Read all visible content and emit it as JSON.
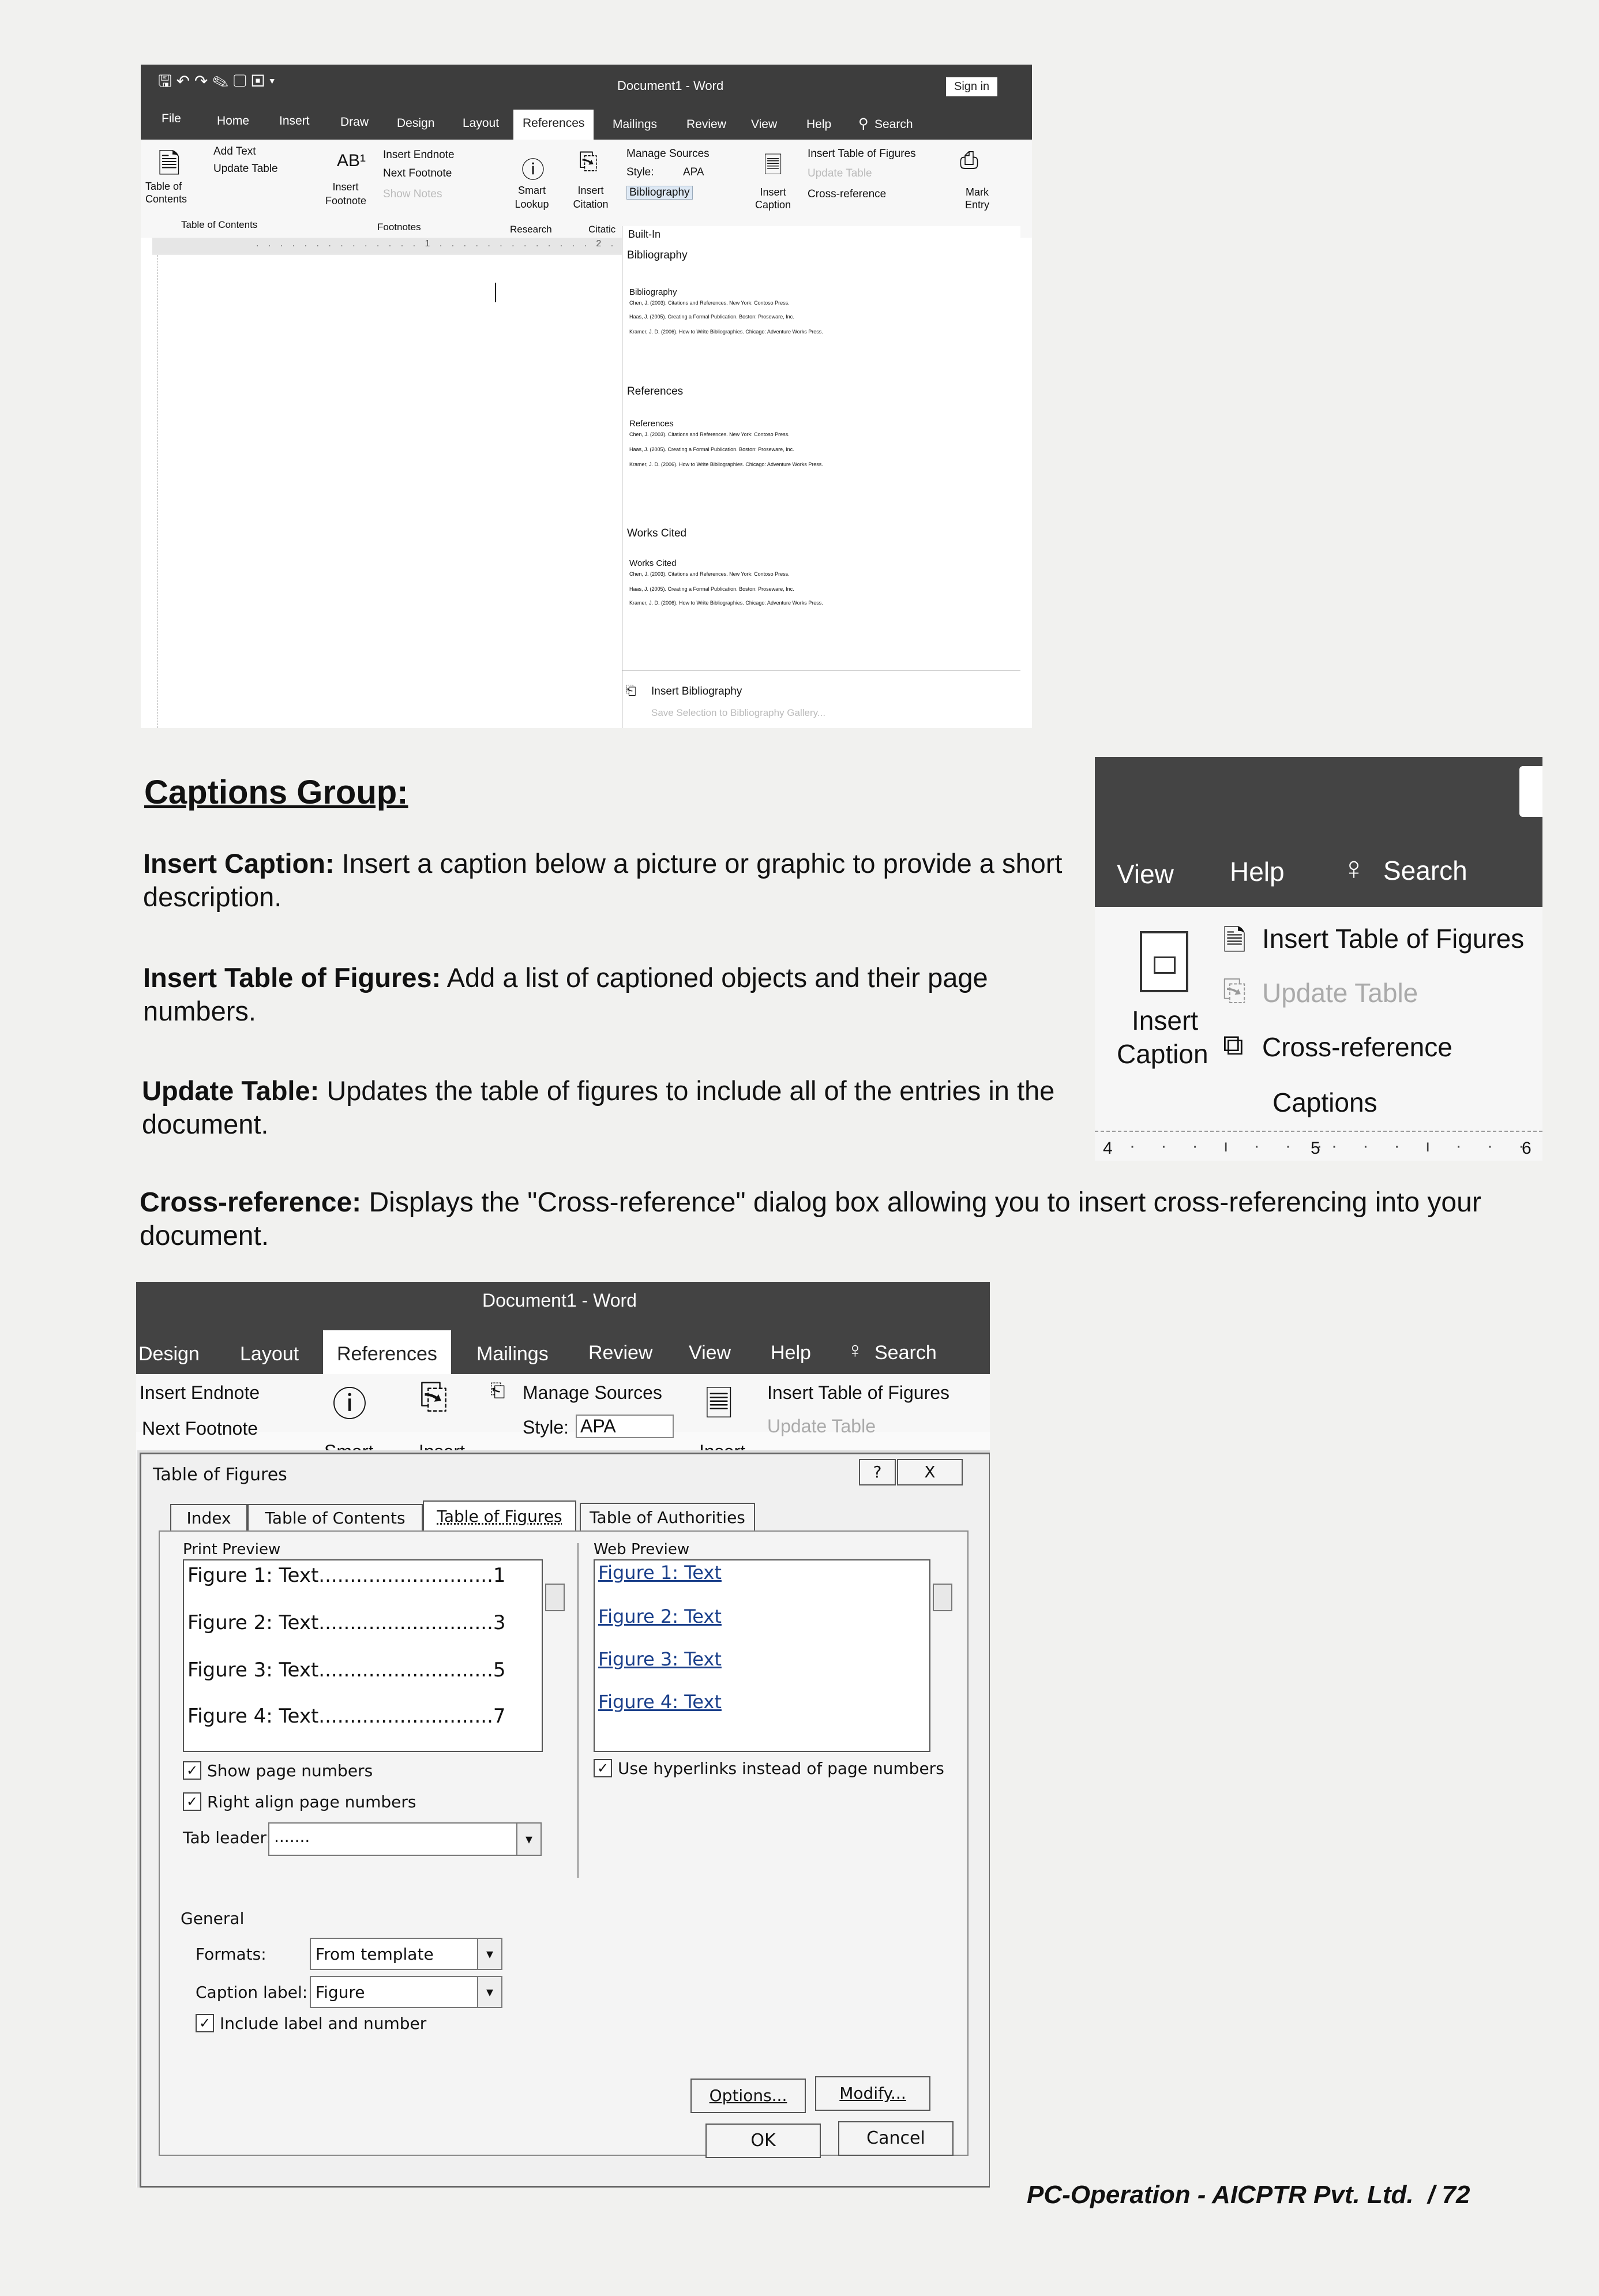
{
  "top_screenshot": {
    "title": "Document1 - Word",
    "sign_in": "Sign in",
    "tabs": [
      "File",
      "Home",
      "Insert",
      "Draw",
      "Design",
      "Layout",
      "References",
      "Mailings",
      "Review",
      "View",
      "Help",
      "Search"
    ],
    "ribbon": {
      "table_of_contents": "Table of Contents",
      "add_text": "Add Text",
      "update_table": "Update Table",
      "group_toc": "Table of Contents",
      "insert_footnote": "Insert Footnote",
      "insert_endnote": "Insert Endnote",
      "next_footnote": "Next Footnote",
      "show_notes": "Show Notes",
      "group_footnotes": "Footnotes",
      "smart_lookup": "Smart Lookup",
      "group_research": "Research",
      "insert_citation": "Insert Citation",
      "manage_sources": "Manage Sources",
      "style_label": "Style:",
      "style_value": "APA",
      "bibliography": "Bibliography",
      "group_citations": "Citatic",
      "insert_caption": "Insert Caption",
      "insert_table_of_figures": "Insert Table of Figures",
      "update_table2": "Update Table",
      "cross_reference": "Cross-reference",
      "mark_entry": "Mark Entry"
    },
    "dropdown": {
      "built_in": "Built-In",
      "sections": [
        {
          "header": "Bibliography",
          "title": "Bibliography"
        },
        {
          "header": "References",
          "title": "References"
        },
        {
          "header": "Works Cited",
          "title": "Works Cited"
        }
      ],
      "entries": [
        "Chen, J. (2003). Citations and References. New York: Contoso Press.",
        "Haas, J. (2005). Creating a Formal Publication. Boston: Proseware, Inc.",
        "Kramer, J. D. (2006). How to Write Bibliographies. Chicago: Adventure Works Press."
      ],
      "insert_bibliography": "Insert Bibliography",
      "save_selection": "Save Selection to Bibliography Gallery..."
    }
  },
  "heading": "Captions Group:",
  "paragraphs": [
    {
      "term": "Insert Caption:",
      "text": " Insert a caption below a picture or graphic to provide a short description."
    },
    {
      "term": "Insert Table of Figures:",
      "text": " Add a list of captioned objects and their page numbers."
    },
    {
      "term": "Update Table:",
      "text": " Updates the table of figures to include all of the entries in the document."
    },
    {
      "term": "Cross-reference:",
      "text": " Displays the \"Cross-reference\" dialog box allowing you to insert cross-referencing into your document."
    }
  ],
  "right_screenshot": {
    "tabs": [
      "View",
      "Help",
      "Search"
    ],
    "insert": "Insert",
    "caption": "Caption",
    "insert_table_of_figures": "Insert Table of Figures",
    "update_table": "Update Table",
    "cross_reference": "Cross-reference",
    "group": "Captions",
    "ruler": [
      "4",
      "5",
      "6"
    ]
  },
  "bottom_screenshot": {
    "title": "Document1 - Word",
    "tabs": [
      "Design",
      "Layout",
      "References",
      "Mailings",
      "Review",
      "View",
      "Help",
      "Search"
    ],
    "insert_endnote": "Insert Endnote",
    "next_footnote": "Next Footnote",
    "smart": "Smart",
    "insert": "Insert",
    "manage_sources": "Manage Sources",
    "style_label": "Style:",
    "style_value": "APA",
    "insert2": "Insert",
    "insert_table_of_figures": "Insert Table of Figures",
    "update_table": "Update Table",
    "dialog": {
      "title": "Table of Figures",
      "help": "?",
      "close": "X",
      "tabs": [
        "Index",
        "Table of Contents",
        "Table of Figures",
        "Table of Authorities"
      ],
      "print_preview": "Print Preview",
      "print_items": [
        "Figure 1: Text............................1",
        "Figure 2: Text............................3",
        "Figure 3: Text............................5",
        "Figure 4: Text............................7"
      ],
      "web_preview": "Web Preview",
      "web_items": [
        "Figure 1: Text",
        "Figure 2: Text",
        "Figure 3: Text",
        "Figure 4: Text"
      ],
      "show_page_numbers": "Show page numbers",
      "right_align": "Right align page numbers",
      "tab_leader": "Tab leader:",
      "tab_leader_value": ".......",
      "use_hyperlinks": "Use hyperlinks instead of page numbers",
      "general": "General",
      "formats": "Formats:",
      "formats_value": "From template",
      "caption_label": "Caption label:",
      "caption_label_value": "Figure",
      "include_label": "Include label and number",
      "options": "Options...",
      "modify": "Modify...",
      "ok": "OK",
      "cancel": "Cancel"
    }
  },
  "footer": "PC-Operation - AICPTR Pvt. Ltd.  / 72"
}
